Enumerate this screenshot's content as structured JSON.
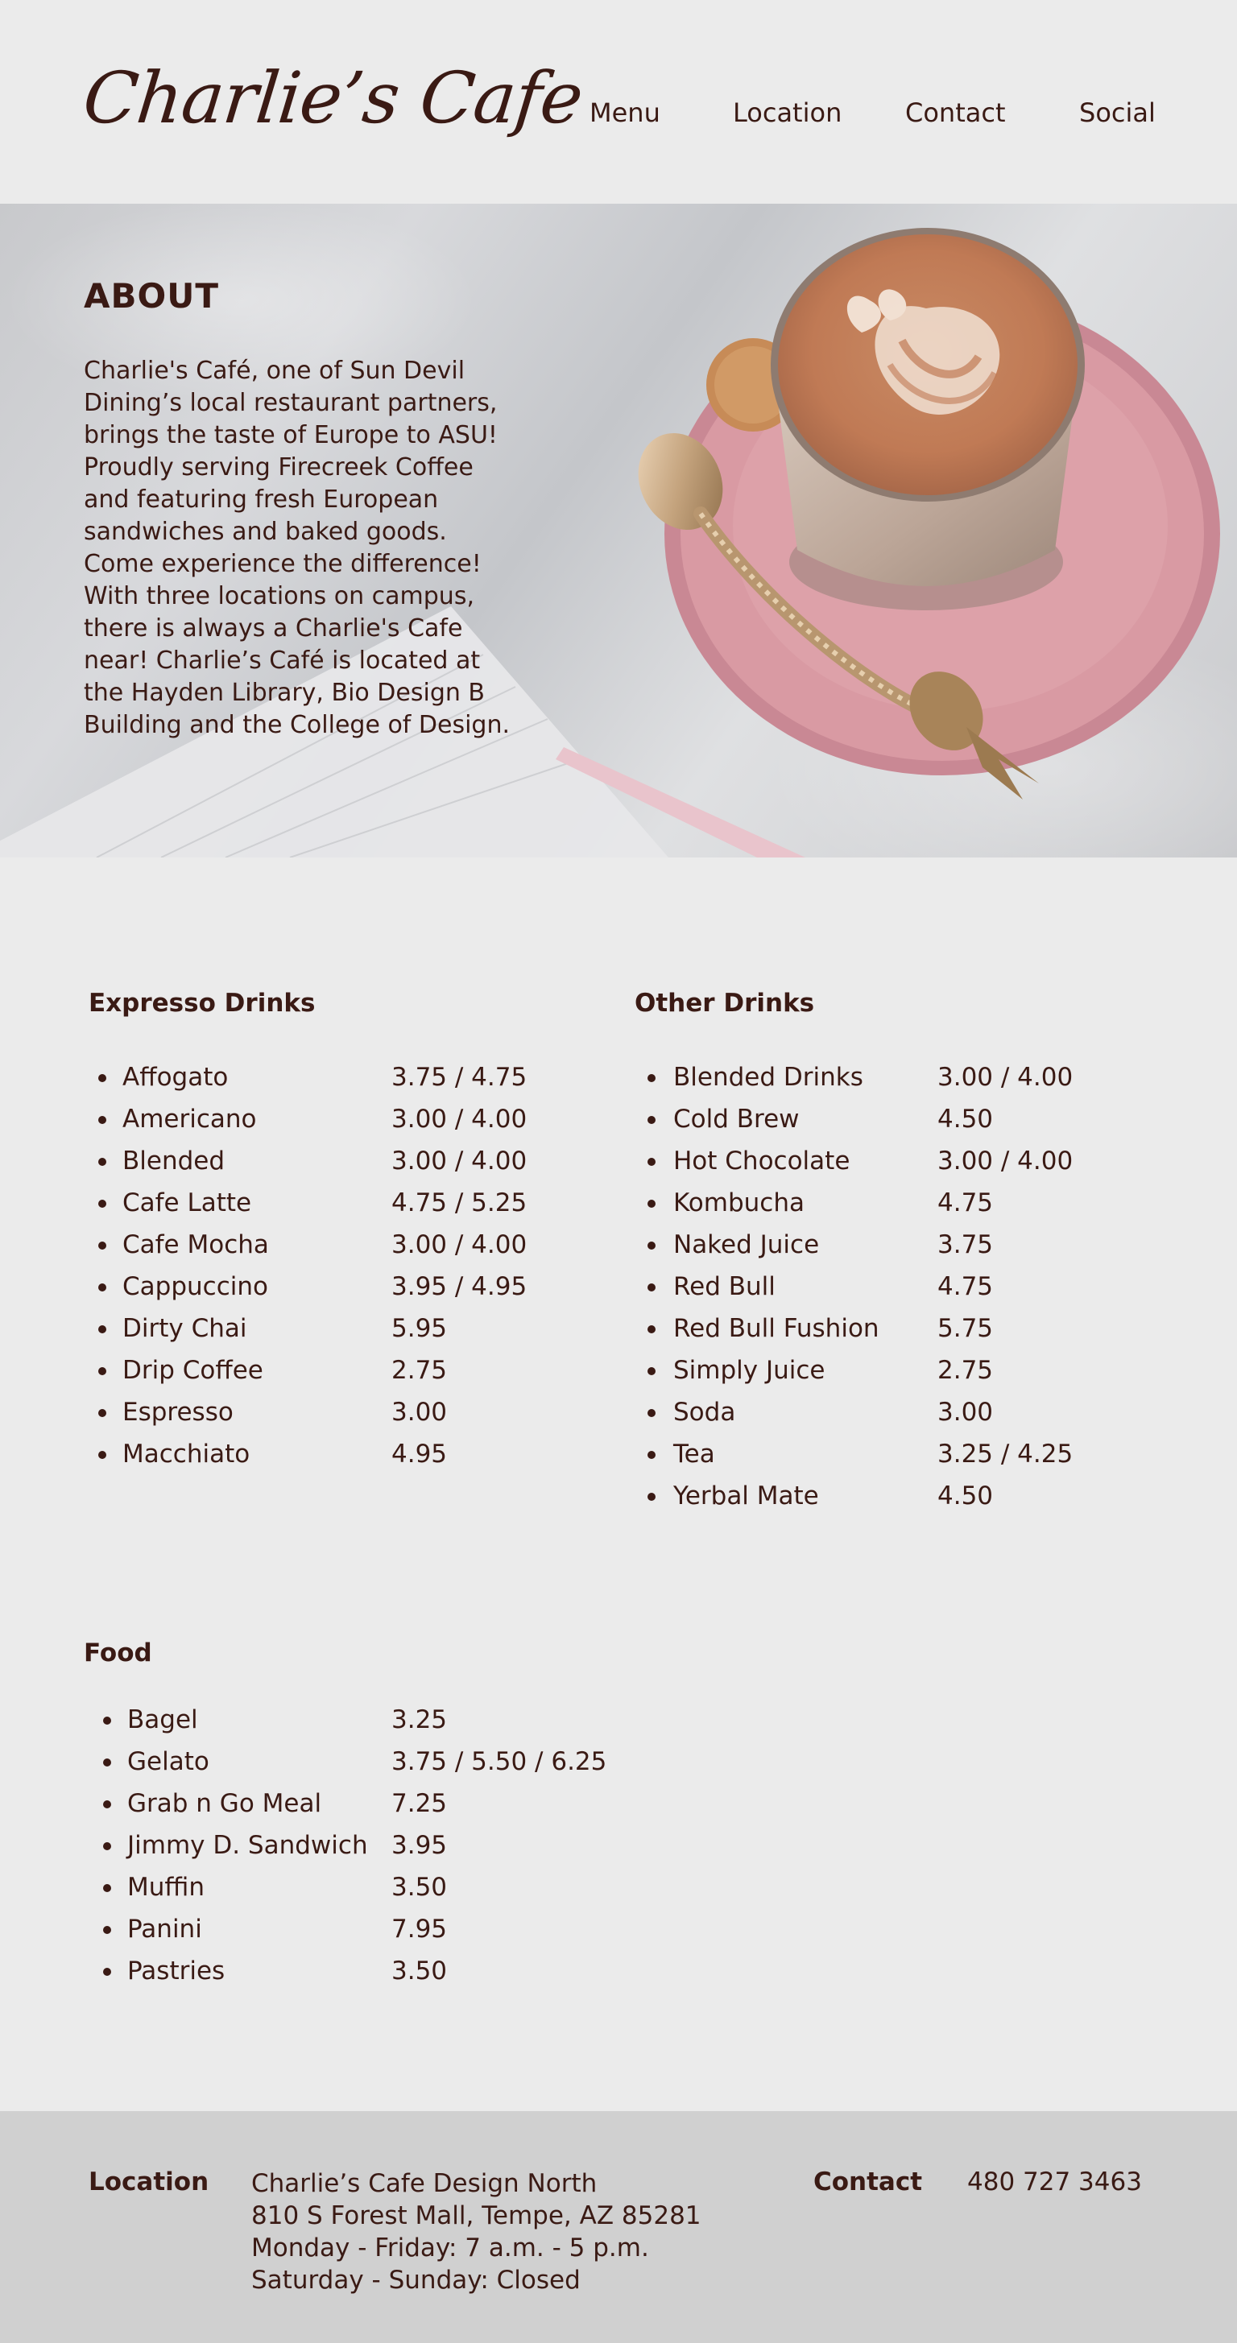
{
  "header": {
    "brand": "Charlie’s Cafe",
    "nav": [
      "Menu",
      "Location",
      "Contact",
      "Social"
    ]
  },
  "about": {
    "title": "ABOUT",
    "lines": [
      "Charlie's Café, one of Sun Devil",
      "Dining’s local restaurant partners,",
      "brings the taste of Europe to ASU!",
      "Proudly serving Firecreek Coffee",
      "and featuring fresh European",
      "sandwiches and baked goods.",
      "Come experience the difference!",
      "With three locations on campus,",
      "there is always a Charlie's Cafe",
      "near! Charlie’s Café is located at",
      "the Hayden Library, Bio Design B",
      "Building and the College of Design."
    ]
  },
  "menu": {
    "expresso": {
      "title": "Expresso Drinks",
      "items": [
        {
          "name": "Affogato",
          "price": "3.75 / 4.75"
        },
        {
          "name": "Americano",
          "price": "3.00 / 4.00"
        },
        {
          "name": "Blended",
          "price": "3.00 / 4.00"
        },
        {
          "name": "Cafe Latte",
          "price": "4.75 / 5.25"
        },
        {
          "name": "Cafe Mocha",
          "price": "3.00 / 4.00"
        },
        {
          "name": "Cappuccino",
          "price": "3.95 / 4.95"
        },
        {
          "name": "Dirty Chai",
          "price": "5.95"
        },
        {
          "name": "Drip Coffee",
          "price": "2.75"
        },
        {
          "name": "Espresso",
          "price": "3.00"
        },
        {
          "name": "Macchiato",
          "price": "4.95"
        }
      ]
    },
    "other": {
      "title": "Other Drinks",
      "items": [
        {
          "name": "Blended Drinks",
          "price": "3.00 / 4.00"
        },
        {
          "name": "Cold Brew",
          "price": "4.50"
        },
        {
          "name": "Hot Chocolate",
          "price": "3.00 / 4.00"
        },
        {
          "name": "Kombucha",
          "price": "4.75"
        },
        {
          "name": "Naked Juice",
          "price": "3.75"
        },
        {
          "name": "Red Bull",
          "price": "4.75"
        },
        {
          "name": "Red Bull Fushion",
          "price": "5.75"
        },
        {
          "name": "Simply Juice",
          "price": "2.75"
        },
        {
          "name": "Soda",
          "price": "3.00"
        },
        {
          "name": "Tea",
          "price": "3.25 / 4.25"
        },
        {
          "name": "Yerbal Mate",
          "price": "4.50"
        }
      ]
    },
    "food": {
      "title": "Food",
      "items": [
        {
          "name": "Bagel",
          "price": "3.25"
        },
        {
          "name": "Gelato",
          "price": "3.75 / 5.50 / 6.25"
        },
        {
          "name": "Grab n Go Meal",
          "price": "7.25"
        },
        {
          "name": "Jimmy D. Sandwich",
          "price": "3.95"
        },
        {
          "name": "Muffin",
          "price": "3.50"
        },
        {
          "name": "Panini",
          "price": "7.95"
        },
        {
          "name": "Pastries",
          "price": "3.50"
        }
      ]
    }
  },
  "footer": {
    "location_label": "Location",
    "address_lines": [
      "Charlie’s Cafe Design North",
      "810 S Forest Mall, Tempe, AZ 85281",
      "Monday - Friday: 7 a.m. - 5 p.m.",
      "Saturday - Sunday: Closed"
    ],
    "contact_label": "Contact",
    "phone": "480 727 3463"
  },
  "colors": {
    "text": "#3a1a14",
    "background": "#ebebeb",
    "footer": "#d0d0d0",
    "saucer": "#d99aa3"
  }
}
